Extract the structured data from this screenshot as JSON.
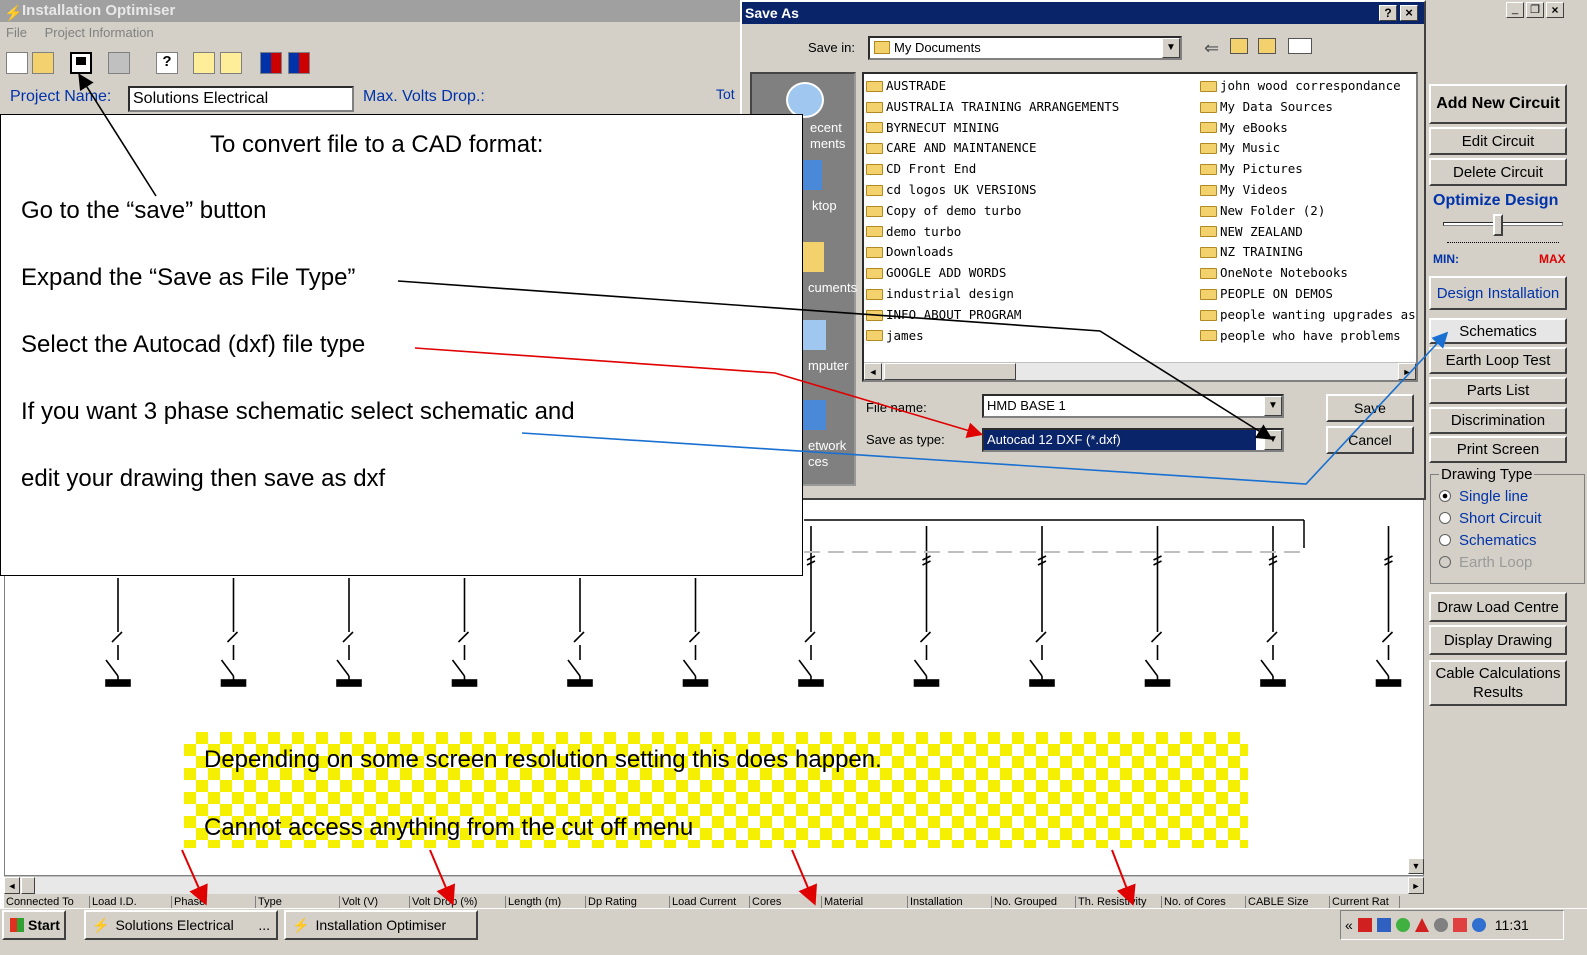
{
  "app": {
    "title": "Installation Optimiser",
    "menu": [
      "File",
      "Project Information"
    ],
    "project_name_label": "Project Name:",
    "project_name_value": "Solutions Electrical",
    "max_volts_label": "Max. Volts Drop.:",
    "tot_label": "Tot",
    "window_controls": [
      "_",
      "❐",
      "×"
    ]
  },
  "right_panel": {
    "buttons": [
      "Add New Circuit",
      "Edit Circuit",
      "Delete Circuit"
    ],
    "optimize_label": "Optimize Design",
    "min_label": "MIN:",
    "max_label": "MAX",
    "slider_level": 0.45,
    "buttons2": [
      "Design Installation",
      "Schematics",
      "Earth Loop Test",
      "Parts List",
      "Discrimination",
      "Print Screen"
    ],
    "drawing_type_label": "Drawing Type",
    "drawing_types": [
      "Single line",
      "Short Circuit",
      "Schematics",
      "Earth Loop"
    ],
    "buttons3": [
      "Draw Load Centre",
      "Display Drawing"
    ],
    "cable_results": "Cable Calculations Results"
  },
  "dialog": {
    "title": "Save As",
    "help": "?",
    "close": "×",
    "save_in_label": "Save in:",
    "save_in_value": "My Documents",
    "places": [
      "Recent Documents",
      "Desktop",
      "My Documents",
      "My Computer",
      "My Network Places"
    ],
    "places_visible": [
      "ecent",
      "ments",
      "ktop",
      "cuments",
      "mputer",
      "etwork",
      "ces"
    ],
    "folders_left": [
      "AUSTRADE",
      "AUSTRALIA TRAINING ARRANGEMENTS",
      "BYRNECUT MINING",
      "CARE AND MAINTANENCE",
      "CD Front End",
      "cd logos UK VERSIONS",
      "Copy of demo turbo",
      "demo turbo",
      "Downloads",
      "GOOGLE ADD WORDS",
      "industrial design",
      "INFO ABOUT PROGRAM",
      "james"
    ],
    "folders_right": [
      "john wood correspondance",
      "My Data Sources",
      "My eBooks",
      "My Music",
      "My Pictures",
      "My Videos",
      "New Folder (2)",
      "NEW ZEALAND",
      "NZ TRAINING",
      "OneNote Notebooks",
      "PEOPLE ON DEMOS",
      "people wanting upgrades as the",
      "people who have problems"
    ],
    "file_name_label": "File name:",
    "file_name_value": "HMD BASE 1",
    "save_type_label": "Save as type:",
    "save_type_value": "Autocad 12 DXF (*.dxf)",
    "save_button": "Save",
    "cancel_button": "Cancel"
  },
  "instructions": {
    "heading": "To convert file to a CAD format:",
    "steps": [
      "Go to the “save” button",
      "Expand the    “Save as File Type”",
      "Select the Autocad (dxf) file type",
      "If you want 3 phase schematic select schematic and",
      "edit your drawing then save as dxf"
    ]
  },
  "note": {
    "line1": "Depending on some screen resolution setting this does happen.",
    "line2": "Cannot access anything from the cut off menu"
  },
  "grid_headers": [
    "Connected To",
    "Load I.D.",
    "Phase",
    "Type",
    "Volt (V)",
    "Volt Drop (%)",
    "Length (m)",
    "Dp Rating",
    "Load Current",
    "Cores",
    "Material",
    "Installation",
    "No. Grouped",
    "Th. Resistivity",
    "No. of Cores",
    "CABLE Size",
    "Current Rat"
  ],
  "taskbar": {
    "start": "Start",
    "tasks": [
      "Solutions Electrical",
      "Installation Optimiser"
    ],
    "tasks_more": "...",
    "chevron": "«",
    "clock": "11:31"
  },
  "colors": {
    "dialog_title": "#0a246a",
    "link_blue": "#0033aa",
    "arrow_red": "#e00000",
    "arrow_blue": "#1a70d0",
    "highlight_yellow": "#f5f000"
  }
}
